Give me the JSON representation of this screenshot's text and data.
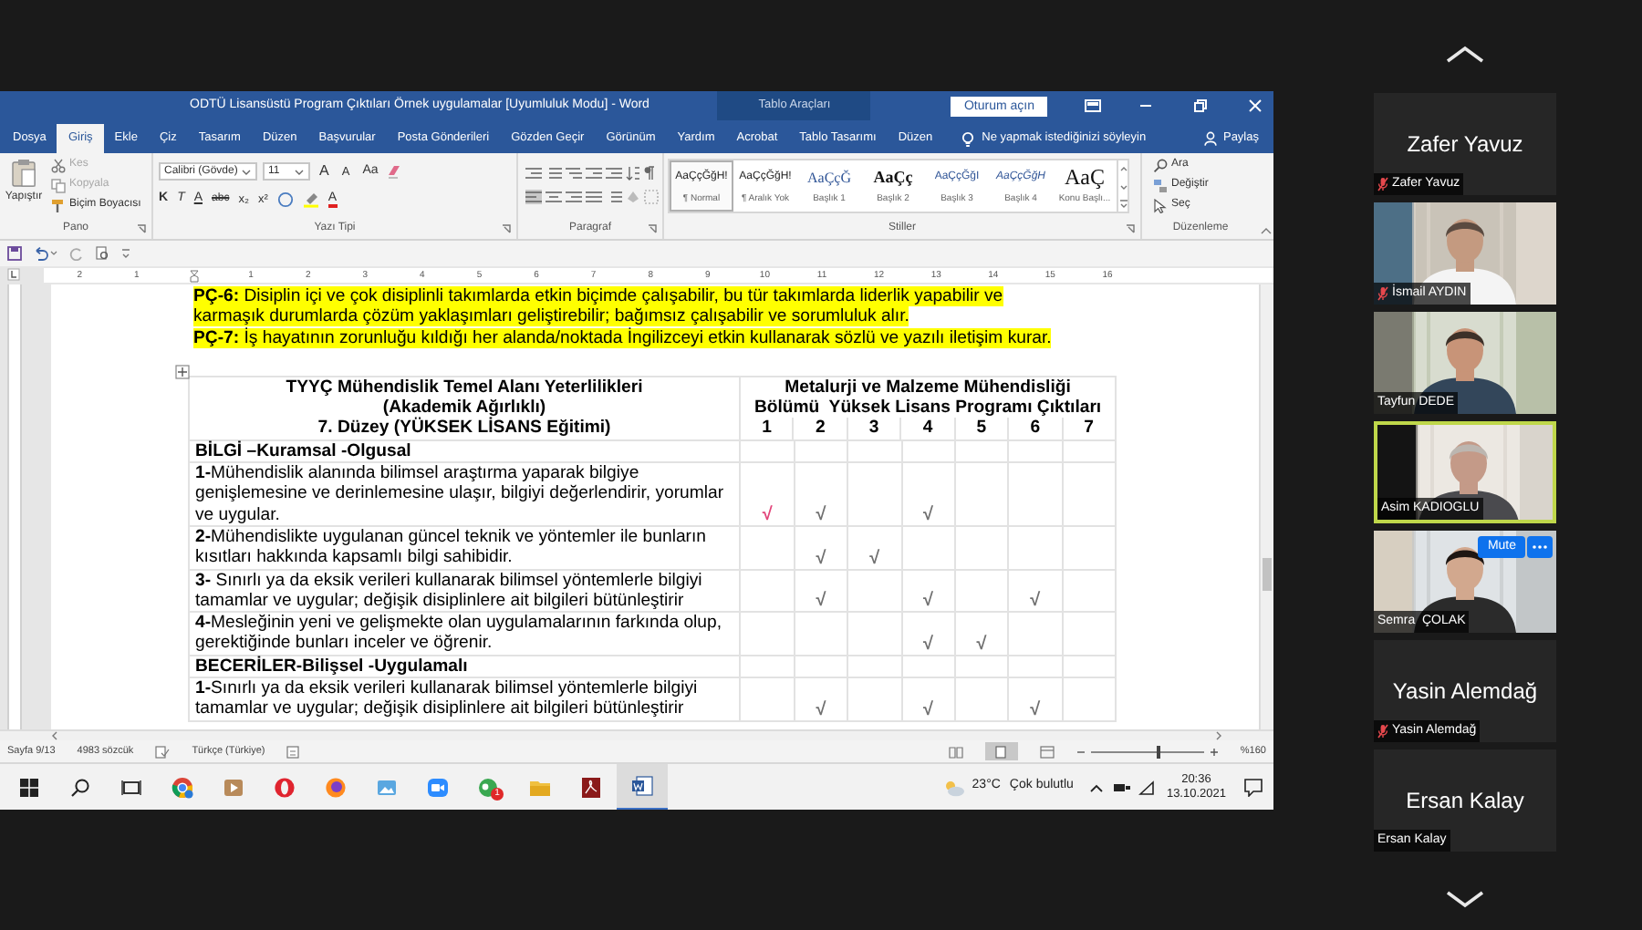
{
  "word": {
    "title": "ODTÜ Lisansüstü Program Çıktıları Örnek uygulamalar [Uyumluluk Modu]  -  Word",
    "context_group": "Tablo Araçları",
    "sign_in": "Oturum açın",
    "tabs": [
      {
        "label": "Dosya",
        "selected": false
      },
      {
        "label": "Giriş",
        "selected": true
      },
      {
        "label": "Ekle",
        "selected": false
      },
      {
        "label": "Çiz",
        "selected": false
      },
      {
        "label": "Tasarım",
        "selected": false
      },
      {
        "label": "Düzen",
        "selected": false
      },
      {
        "label": "Başvurular",
        "selected": false
      },
      {
        "label": "Posta Gönderileri",
        "selected": false
      },
      {
        "label": "Gözden Geçir",
        "selected": false
      },
      {
        "label": "Görünüm",
        "selected": false
      },
      {
        "label": "Yardım",
        "selected": false
      },
      {
        "label": "Acrobat",
        "selected": false
      },
      {
        "label": "Tablo Tasarımı",
        "selected": false
      },
      {
        "label": "Düzen",
        "selected": false
      }
    ],
    "tell_me": "Ne yapmak istediğinizi söyleyin",
    "share": "Paylaş",
    "ribbon": {
      "clipboard": {
        "paste": "Yapıştır",
        "items": [
          {
            "label": "Kes",
            "disabled": true
          },
          {
            "label": "Kopyala",
            "disabled": true
          },
          {
            "label": "Biçim Boyacısı",
            "disabled": false
          }
        ],
        "label": "Pano"
      },
      "font": {
        "name": "Calibri (Gövde)",
        "size": "11",
        "grow": "A",
        "shrink": "A",
        "case": "Aa",
        "bold": "K",
        "italic": "T",
        "underline": "A",
        "strike": "abc",
        "subscript": "x₂",
        "superscript": "x²",
        "font_color": "A",
        "label": "Yazı Tipi"
      },
      "paragraph": {
        "label": "Paragraf"
      },
      "styles": {
        "items": [
          {
            "preview": "AaÇçĞğH!",
            "name": "¶ Normal",
            "selected": true
          },
          {
            "preview": "AaÇçĞğH!",
            "name": "¶ Aralık Yok",
            "selected": false
          },
          {
            "preview": "AaÇçĞ",
            "name": "Başlık 1",
            "selected": false
          },
          {
            "preview": "AaÇç",
            "name": "Başlık 2",
            "selected": false
          },
          {
            "preview": "AaÇçĞğI",
            "name": "Başlık 3",
            "selected": false
          },
          {
            "preview": "AaÇçĞğH",
            "name": "Başlık 4",
            "selected": false
          },
          {
            "preview": "AaÇ",
            "name": "Konu Başlı...",
            "selected": false
          }
        ],
        "label": "Stiller"
      },
      "editing": {
        "find": "Ara",
        "replace": "Değiştir",
        "select": "Seç",
        "label": "Düzenleme"
      }
    }
  },
  "ruler": {
    "left_labels": [
      "2",
      "1"
    ],
    "right_labels": [
      "1",
      "2",
      "3",
      "4",
      "5",
      "6",
      "7",
      "8",
      "9",
      "10",
      "11",
      "12",
      "13",
      "14",
      "15",
      "16"
    ]
  },
  "document": {
    "paragraphs": [
      "**PÇ-6:** Disiplin içi ve çok disiplinli takımlarda etkin biçimde çalışabilir, bu tür takımlarda liderlik yapabilir ve karmaşık durumlarda çözüm yaklaşımları geliştirebilir; bağımsız çalışabilir ve sorumluluk alır.",
      "**PÇ-7:** İş hayatının zorunluğu kıldığı her alanda/noktada İngilizceyi etkin kullanarak sözlü ve yazılı iletişim kurar."
    ],
    "table": {
      "header_left": [
        "TYYÇ Mühendislik Temel Alanı Yeterlilikleri",
        "(Akademik Ağırlıklı)",
        "7. Düzey (YÜKSEK LİSANS Eğitimi)"
      ],
      "header_right": [
        "Metalurji ve Malzeme Mühendisliği",
        "Bölümü  Yüksek Lisans Programı Çıktıları"
      ],
      "columns": [
        "1",
        "2",
        "3",
        "4",
        "5",
        "6",
        "7"
      ],
      "rows": [
        {
          "kind": "section",
          "text": "BİLGİ –Kuramsal -Olgusal"
        },
        {
          "kind": "item",
          "text": "**1-**Mühendislik alanında bilimsel araştırma yaparak bilgiye genişlemesine ve derinlemesine ulaşır, bilgiyi değerlendirir, yorumlar ve uygular.",
          "cells": [
            {
              "kind": "mark",
              "text": "√",
              "color": "#e2457a"
            },
            {
              "kind": "mark",
              "text": "√",
              "color": "#707070"
            },
            {
              "kind": "blank"
            },
            {
              "kind": "mark",
              "text": "√",
              "color": "#707070"
            },
            {
              "kind": "blank"
            },
            {
              "kind": "blank"
            },
            {
              "kind": "blank"
            }
          ]
        },
        {
          "kind": "item",
          "text": "**2-**Mühendislikte uygulanan güncel teknik ve yöntemler ile bunların kısıtları hakkında kapsamlı bilgi sahibidir.",
          "cells": [
            {
              "kind": "blank"
            },
            {
              "kind": "mark",
              "text": "√",
              "color": "#707070"
            },
            {
              "kind": "mark",
              "text": "√",
              "color": "#707070"
            },
            {
              "kind": "blank"
            },
            {
              "kind": "blank"
            },
            {
              "kind": "blank"
            },
            {
              "kind": "blank"
            }
          ]
        },
        {
          "kind": "item",
          "text": "**3-** Sınırlı ya da eksik verileri kullanarak bilimsel yöntemlerle bilgiyi tamamlar ve uygular; değişik disiplinlere ait bilgileri bütünleştirir",
          "cells": [
            {
              "kind": "blank"
            },
            {
              "kind": "mark",
              "text": "√",
              "color": "#707070"
            },
            {
              "kind": "blank"
            },
            {
              "kind": "mark",
              "text": "√",
              "color": "#707070"
            },
            {
              "kind": "blank"
            },
            {
              "kind": "mark",
              "text": "√",
              "color": "#707070"
            },
            {
              "kind": "blank"
            }
          ]
        },
        {
          "kind": "item",
          "text": "**4-**Mesleğinin yeni ve gelişmekte olan uygulamalarının farkında olup, gerektiğinde bunları inceler ve öğrenir.",
          "cells": [
            {
              "kind": "blank"
            },
            {
              "kind": "blank"
            },
            {
              "kind": "blank"
            },
            {
              "kind": "mark",
              "text": "√",
              "color": "#707070"
            },
            {
              "kind": "mark",
              "text": "√",
              "color": "#707070"
            },
            {
              "kind": "blank"
            },
            {
              "kind": "blank"
            }
          ]
        },
        {
          "kind": "section",
          "text": "BECERİLER-Bilişsel -Uygulamalı"
        },
        {
          "kind": "item",
          "text": "**1-**Sınırlı ya da eksik verileri kullanarak bilimsel yöntemlerle bilgiyi tamamlar ve uygular; değişik disiplinlere ait bilgileri bütünleştirir",
          "cells": [
            {
              "kind": "blank"
            },
            {
              "kind": "mark",
              "text": "√",
              "color": "#707070"
            },
            {
              "kind": "blank"
            },
            {
              "kind": "mark",
              "text": "√",
              "color": "#707070"
            },
            {
              "kind": "blank"
            },
            {
              "kind": "mark",
              "text": "√",
              "color": "#707070"
            },
            {
              "kind": "blank"
            }
          ]
        }
      ]
    }
  },
  "status_bar": {
    "page": "Sayfa 9/13",
    "words": "4983 sözcük",
    "language": "Türkçe (Türkiye)",
    "zoom_slider": {
      "level": 0.58
    },
    "zoom": "%160"
  },
  "taskbar": {
    "badge": "1",
    "temperature": "23°C",
    "condition": "Çok bulutlu",
    "time": "20:36",
    "date": "13.10.2021"
  },
  "participants": [
    {
      "kind": "name_tile",
      "display_name": "Zafer Yavuz",
      "label": "Zafer Yavuz",
      "muted": true,
      "active": false
    },
    {
      "kind": "video",
      "label": "İsmail AYDIN",
      "muted": true,
      "active": false
    },
    {
      "kind": "video",
      "label": "Tayfun DEDE",
      "muted": false,
      "active": false
    },
    {
      "kind": "video",
      "label": "Asim KADIOGLU",
      "muted": false,
      "active": true
    },
    {
      "kind": "video",
      "label": "Semra  ÇOLAK",
      "muted": false,
      "active": false,
      "mute_button": "Mute"
    },
    {
      "kind": "name_tile",
      "display_name": "Yasin Alemdağ",
      "label": "Yasin Alemdağ",
      "muted": true,
      "active": false
    },
    {
      "kind": "name_tile",
      "display_name": "Ersan Kalay",
      "label": "Ersan Kalay",
      "muted": false,
      "active": false
    }
  ]
}
